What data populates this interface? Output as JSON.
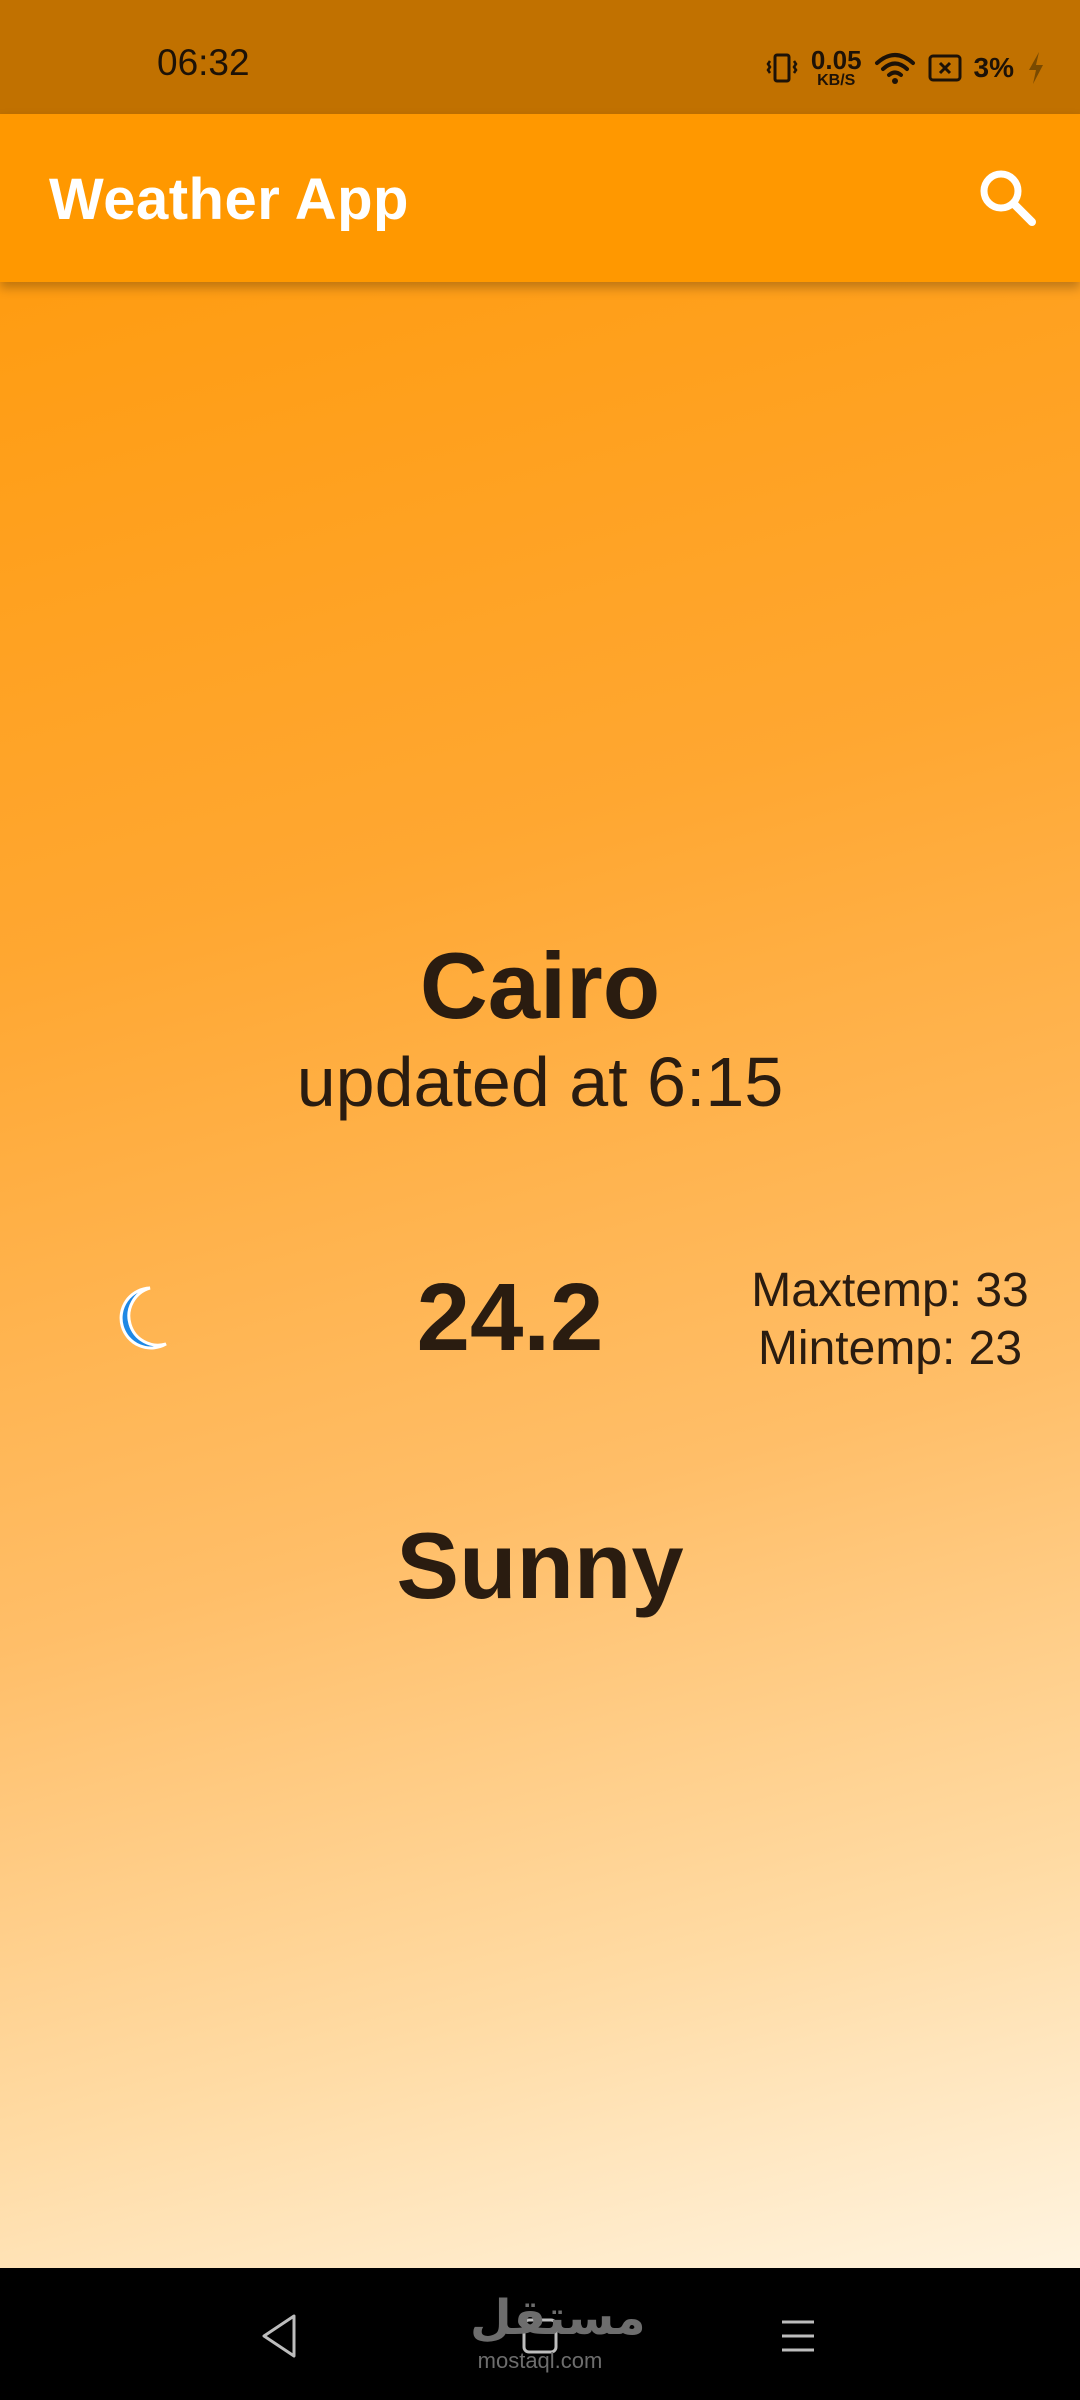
{
  "status_bar": {
    "time": "06:32",
    "net_speed_value": "0.05",
    "net_speed_unit": "KB/S",
    "battery_percent": "3%"
  },
  "app_bar": {
    "title": "Weather App",
    "search_icon": "search-icon"
  },
  "weather": {
    "city": "Cairo",
    "updated": "updated at 6:15",
    "condition_icon": "moon-icon",
    "temperature": "24.2",
    "max_temp": "Maxtemp: 33",
    "min_temp": "Mintemp: 23",
    "condition": "Sunny"
  },
  "nav_bar": {
    "back_icon": "back-icon",
    "home_icon": "home-icon",
    "menu_icon": "menu-icon"
  },
  "watermark": {
    "arabic": "مستقل",
    "latin": "mostaql.com"
  },
  "colors": {
    "status_bar": "#c17100",
    "app_bar": "#ff9800",
    "text_dark": "#2a1c10",
    "moon": "#1e88e5"
  }
}
